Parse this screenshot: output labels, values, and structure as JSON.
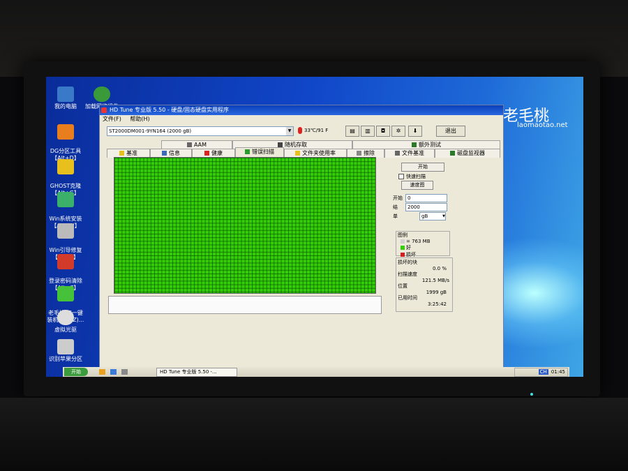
{
  "desktop": {
    "icons": [
      {
        "label": "我的电脑",
        "color": "#3a78c8"
      },
      {
        "label": "DG分区工具\n【Alt+D】",
        "color": "#e87e1e"
      },
      {
        "label": "GHOST克隆\n【Alt+G】",
        "color": "#e8c01e"
      },
      {
        "label": "Win系统安装\n【Alt+W】",
        "color": "#3ab06a"
      },
      {
        "label": "Win引导修复\n【Alt+F】",
        "color": "#bbbbbb"
      },
      {
        "label": "登录密码清除\n【Alt+C】",
        "color": "#d23a2a"
      },
      {
        "label": "老毛桃PE一键\n装机(Alt+Z)...",
        "color": "#46c23a"
      },
      {
        "label": "虚拟光驱",
        "color": "#dddddd"
      },
      {
        "label": "识别苹果分区",
        "color": "#cccccc"
      },
      {
        "label": "加载网络组件",
        "color": "#3a9a3a"
      }
    ],
    "brand": "老毛桃",
    "brand_url": "laomaotao.net"
  },
  "window": {
    "title": "HD Tune 专业版 5.50 - 硬盘/固态硬盘实用程序",
    "menu": [
      "文件(F)",
      "帮助(H)"
    ],
    "drive": "ST2000DM001-9YN164 (2000 gB)",
    "temperature": "33℃/91 F",
    "exit_label": "退出",
    "tabs_top": [
      "AAM",
      "随机存取",
      "额外测试"
    ],
    "tabs_bottom": [
      "基准",
      "信息",
      "健康",
      "错误扫描",
      "文件夹使用率",
      "擦除",
      "文件基准",
      "磁盘监视器"
    ],
    "side": {
      "start_label": "开始",
      "quick_scan_label": "快速扫描",
      "speed_map_label": "速度图",
      "start_field_label": "开始",
      "start_value": "0",
      "end_field_label": "结",
      "end_value": "2000",
      "unit_label": "单",
      "unit_value": "gB",
      "legend_title": "图例",
      "legend_block": "= 763 MB",
      "legend_good": "好",
      "legend_bad": "损坏",
      "bad_blocks_label": "损坏的块",
      "bad_blocks_value": "0.0 %",
      "scan_speed_label": "扫描速度",
      "scan_speed_value": "121.5 MB/s",
      "position_label": "位置",
      "position_value": "1999 gB",
      "elapsed_label": "已用时间",
      "elapsed_value": "3:25:42"
    },
    "colors": {
      "good": "#35cc08",
      "bad": "#d02020",
      "block": "#d0d0d0"
    }
  },
  "taskbar": {
    "start_label": "开始",
    "task_label": "HD Tune 专业版 5.50 -...",
    "clock": "01:45",
    "ime": "CH"
  }
}
